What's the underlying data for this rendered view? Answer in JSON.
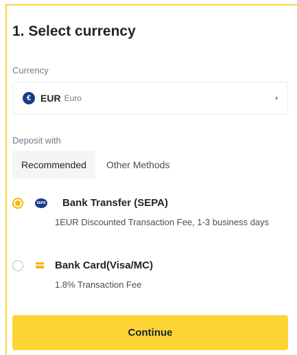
{
  "section": {
    "title": "1. Select currency"
  },
  "currency": {
    "label": "Currency",
    "coin_glyph": "€",
    "code": "EUR",
    "name": "Euro"
  },
  "deposit": {
    "label": "Deposit with",
    "tabs": [
      {
        "label": "Recommended",
        "active": true
      },
      {
        "label": "Other Methods",
        "active": false
      }
    ],
    "methods": [
      {
        "title": "Bank Transfer (SEPA)",
        "icon_text": "SEPA",
        "icon": "sepa-logo-icon",
        "description": "1EUR Discounted Transaction Fee, 1-3 business days",
        "selected": true
      },
      {
        "title": "Bank Card(Visa/MC)",
        "icon": "card-icon",
        "description": "1.8% Transaction Fee",
        "selected": false
      }
    ]
  },
  "actions": {
    "continue_label": "Continue"
  },
  "colors": {
    "accent": "#fcd535",
    "radio_selected": "#f0b90b",
    "text_primary": "#1e2329",
    "text_secondary": "#707a8a"
  }
}
